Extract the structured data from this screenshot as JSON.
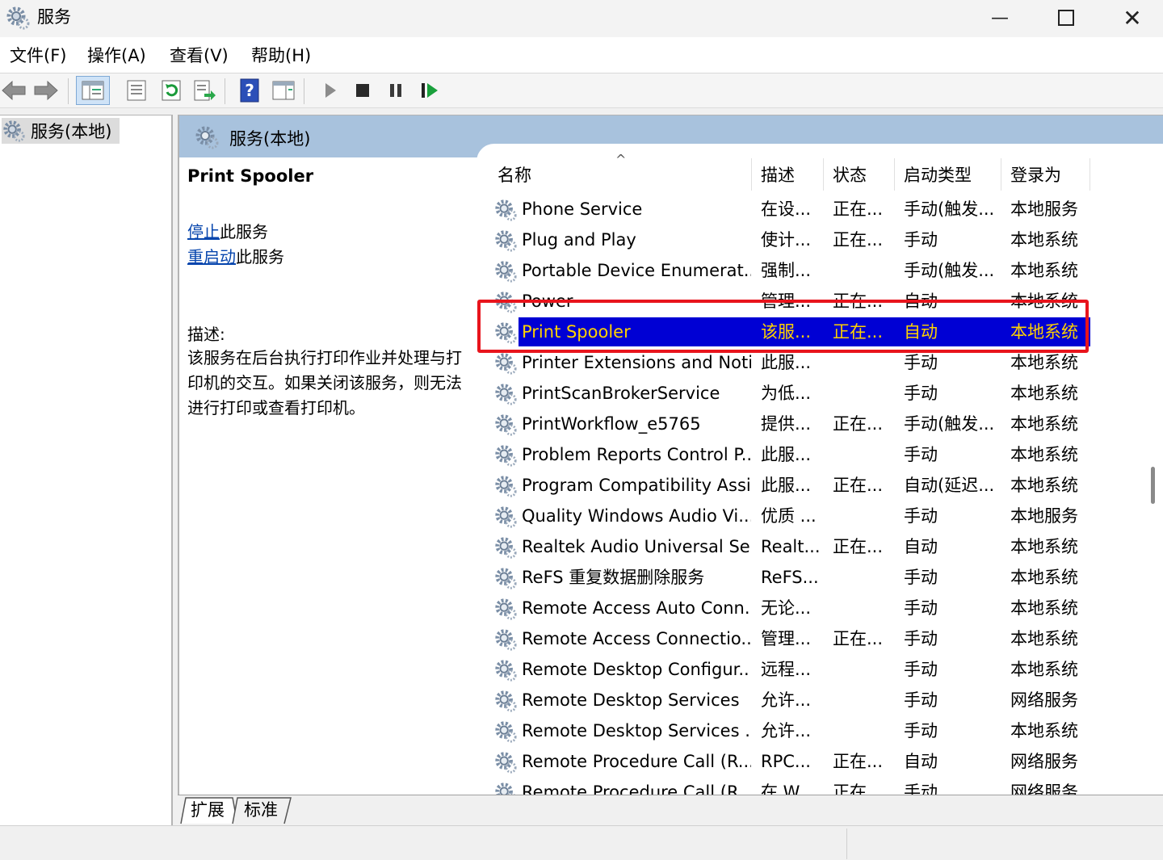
{
  "window": {
    "title": "服务"
  },
  "menu": [
    "文件(F)",
    "操作(A)",
    "查看(V)",
    "帮助(H)"
  ],
  "tree": {
    "root_label": "服务(本地)"
  },
  "panel": {
    "title": "服务(本地)"
  },
  "details": {
    "service_name": "Print Spooler",
    "stop_link": "停止",
    "stop_suffix": "此服务",
    "restart_link": "重启动",
    "restart_suffix": "此服务",
    "desc_label": "描述:",
    "desc_text": "该服务在后台执行打印作业并处理与打印机的交互。如果关闭该服务，则无法进行打印或查看打印机。"
  },
  "columns": [
    "名称",
    "描述",
    "状态",
    "启动类型",
    "登录为"
  ],
  "rows": [
    {
      "name": "Phone Service",
      "desc": "在设...",
      "status": "正在...",
      "startup": "手动(触发...",
      "logon": "本地服务"
    },
    {
      "name": "Plug and Play",
      "desc": "使计...",
      "status": "正在...",
      "startup": "手动",
      "logon": "本地系统"
    },
    {
      "name": "Portable Device Enumerat...",
      "desc": "强制...",
      "status": "",
      "startup": "手动(触发...",
      "logon": "本地系统"
    },
    {
      "name": "Power",
      "desc": "管理...",
      "status": "正在...",
      "startup": "自动",
      "logon": "本地系统"
    },
    {
      "name": "Print Spooler",
      "desc": "该服...",
      "status": "正在...",
      "startup": "自动",
      "logon": "本地系统",
      "selected": true
    },
    {
      "name": "Printer Extensions and Noti...",
      "desc": "此服...",
      "status": "",
      "startup": "手动",
      "logon": "本地系统"
    },
    {
      "name": "PrintScanBrokerService",
      "desc": "为低...",
      "status": "",
      "startup": "手动",
      "logon": "本地系统"
    },
    {
      "name": "PrintWorkflow_e5765",
      "desc": "提供...",
      "status": "正在...",
      "startup": "手动(触发...",
      "logon": "本地系统"
    },
    {
      "name": "Problem Reports Control P...",
      "desc": "此服...",
      "status": "",
      "startup": "手动",
      "logon": "本地系统"
    },
    {
      "name": "Program Compatibility Assi...",
      "desc": "此服...",
      "status": "正在...",
      "startup": "自动(延迟...",
      "logon": "本地系统"
    },
    {
      "name": "Quality Windows Audio Vi...",
      "desc": "优质 ...",
      "status": "",
      "startup": "手动",
      "logon": "本地服务"
    },
    {
      "name": "Realtek Audio Universal Se...",
      "desc": "Realt...",
      "status": "正在...",
      "startup": "自动",
      "logon": "本地系统"
    },
    {
      "name": "ReFS 重复数据删除服务",
      "desc": "ReFS...",
      "status": "",
      "startup": "手动",
      "logon": "本地系统"
    },
    {
      "name": "Remote Access Auto Conn...",
      "desc": "无论...",
      "status": "",
      "startup": "手动",
      "logon": "本地系统"
    },
    {
      "name": "Remote Access Connectio...",
      "desc": "管理...",
      "status": "正在...",
      "startup": "手动",
      "logon": "本地系统"
    },
    {
      "name": "Remote Desktop Configur...",
      "desc": "远程...",
      "status": "",
      "startup": "手动",
      "logon": "本地系统"
    },
    {
      "name": "Remote Desktop Services",
      "desc": "允许...",
      "status": "",
      "startup": "手动",
      "logon": "网络服务"
    },
    {
      "name": "Remote Desktop Services ...",
      "desc": "允许...",
      "status": "",
      "startup": "手动",
      "logon": "本地系统"
    },
    {
      "name": "Remote Procedure Call (R...",
      "desc": "RPC...",
      "status": "正在...",
      "startup": "自动",
      "logon": "网络服务"
    },
    {
      "name": "Remote Procedure Call (R...",
      "desc": "在 W...",
      "status": "正在...",
      "startup": "手动",
      "logon": "网络服务"
    }
  ],
  "tabs": [
    "扩展",
    "标准"
  ],
  "colors": {
    "selection": "#0000d4",
    "selection_text": "#ffd200",
    "highlight_box": "#e8141c",
    "header_band": "#a8c2dd"
  }
}
